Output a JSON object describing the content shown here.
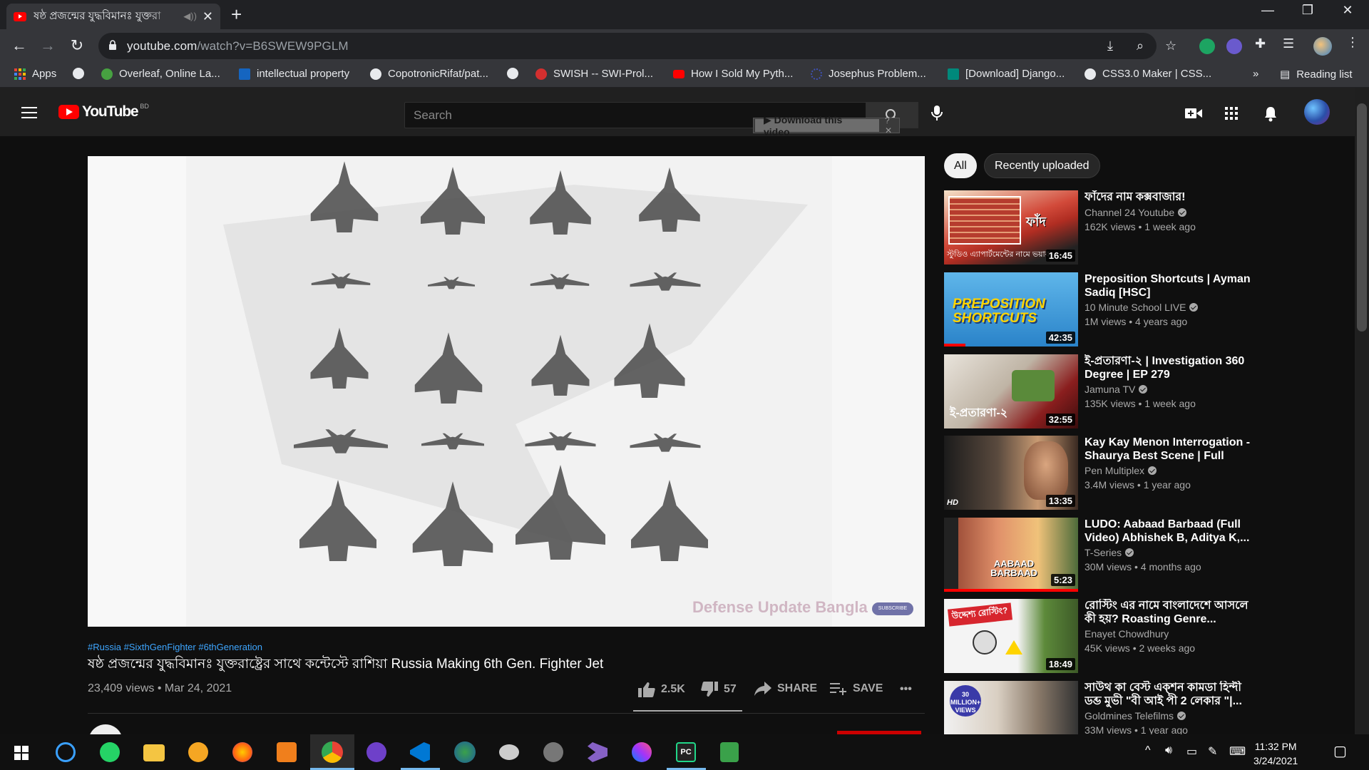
{
  "browser": {
    "tab_title": "ষষ্ঠ প্রজন্মের যুদ্ধবিমানঃ যুক্তরা",
    "tab_close": "✕",
    "new_tab": "+",
    "url_domain": "youtube.com",
    "url_path": "/watch?v=B6SWEW9PGLM",
    "bookmarks": [
      {
        "label": "Apps",
        "color": "#4285f4"
      },
      {
        "label": "",
        "color": "#e8eaed"
      },
      {
        "label": "Overleaf, Online La...",
        "color": "#47a141"
      },
      {
        "label": "intellectual property",
        "color": "#1565c0"
      },
      {
        "label": "CopotronicRifat/pat...",
        "color": "#e8eaed"
      },
      {
        "label": "",
        "color": "#e8eaed"
      },
      {
        "label": "SWISH -- SWI-Prol...",
        "color": "#d32f2f"
      },
      {
        "label": "How I Sold My Pyth...",
        "color": "#ff0000"
      },
      {
        "label": "Josephus Problem...",
        "color": "#3f51b5"
      },
      {
        "label": "[Download] Django...",
        "color": "#00897b"
      },
      {
        "label": "CSS3.0 Maker | CSS...",
        "color": "#e8eaed"
      }
    ],
    "bookmarks_more": "»",
    "reading_list": "Reading list"
  },
  "youtube": {
    "logo_text": "YouTube",
    "logo_region": "BD",
    "search_placeholder": "Search",
    "download_label": "▶ Download this video",
    "download_help": "? ✕"
  },
  "video": {
    "watermark": "Defense Update Bangla",
    "subscribe_badge": "SUBSCRIBE",
    "hashtags": "#Russia #SixthGenFighter #6thGeneration",
    "title": "ষষ্ঠ প্রজন্মের যুদ্ধবিমানঃ যুক্তরাষ্ট্রের সাথে কন্টেস্টে রাশিয়া Russia Making 6th Gen. Fighter Jet",
    "views_date": "23,409 views • Mar 24, 2021",
    "likes": "2.5K",
    "dislikes": "57",
    "share_label": "SHARE",
    "save_label": "SAVE",
    "more_label": "•••"
  },
  "chips": [
    "All",
    "Recently uploaded"
  ],
  "related": [
    {
      "title": "ফাঁদের নাম কক্সবাজার!",
      "channel": "Channel 24 Youtube",
      "stats": "162K views • 1 week ago",
      "duration": "16:45",
      "thumb_text": "স্টুডিও এ্যাপার্টমেন্টের নামে ভয়াব"
    },
    {
      "title": "Preposition Shortcuts | Ayman Sadiq [HSC]",
      "channel": "10 Minute School LIVE",
      "stats": "1M views • 4 years ago",
      "duration": "42:35",
      "thumb_text": "PREPOSITION SHORTCUTS"
    },
    {
      "title": "ই-প্রতারণা-২ | Investigation 360 Degree | EP 279",
      "channel": "Jamuna TV",
      "stats": "135K views • 1 week ago",
      "duration": "32:55",
      "thumb_text": "ই-প্রতারণা-২"
    },
    {
      "title": "Kay Kay Menon Interrogation - Shaurya Best Scene | Full Hind...",
      "channel": "Pen Multiplex",
      "stats": "3.4M views • 1 year ago",
      "duration": "13:35",
      "thumb_text": "HD"
    },
    {
      "title": "LUDO: Aabaad Barbaad (Full Video) Abhishek B, Aditya K,...",
      "channel": "T-Series",
      "stats": "30M views • 4 months ago",
      "duration": "5:23",
      "thumb_text": "AABAAD BARBAAD"
    },
    {
      "title": "রোস্টিং এর নামে বাংলাদেশে আসলে কী হয়? Roasting Genre...",
      "channel": "Enayet Chowdhury",
      "stats": "45K views • 2 weeks ago",
      "duration": "18:49",
      "thumb_text": "উদ্দেশ্য রোস্টিং?"
    },
    {
      "title": "সাউথ কা বেস্ট এক্শন কামডা হিন্দী ডব্ড মুভী \"বী আই পী 2 লেকার \"|...",
      "channel": "Goldmines Telefilms",
      "stats": "33M views • 1 year ago",
      "duration": "",
      "thumb_text": "30 MILLION+ VIEWS"
    }
  ],
  "taskbar": {
    "time": "11:32 PM",
    "date": "3/24/2021"
  }
}
